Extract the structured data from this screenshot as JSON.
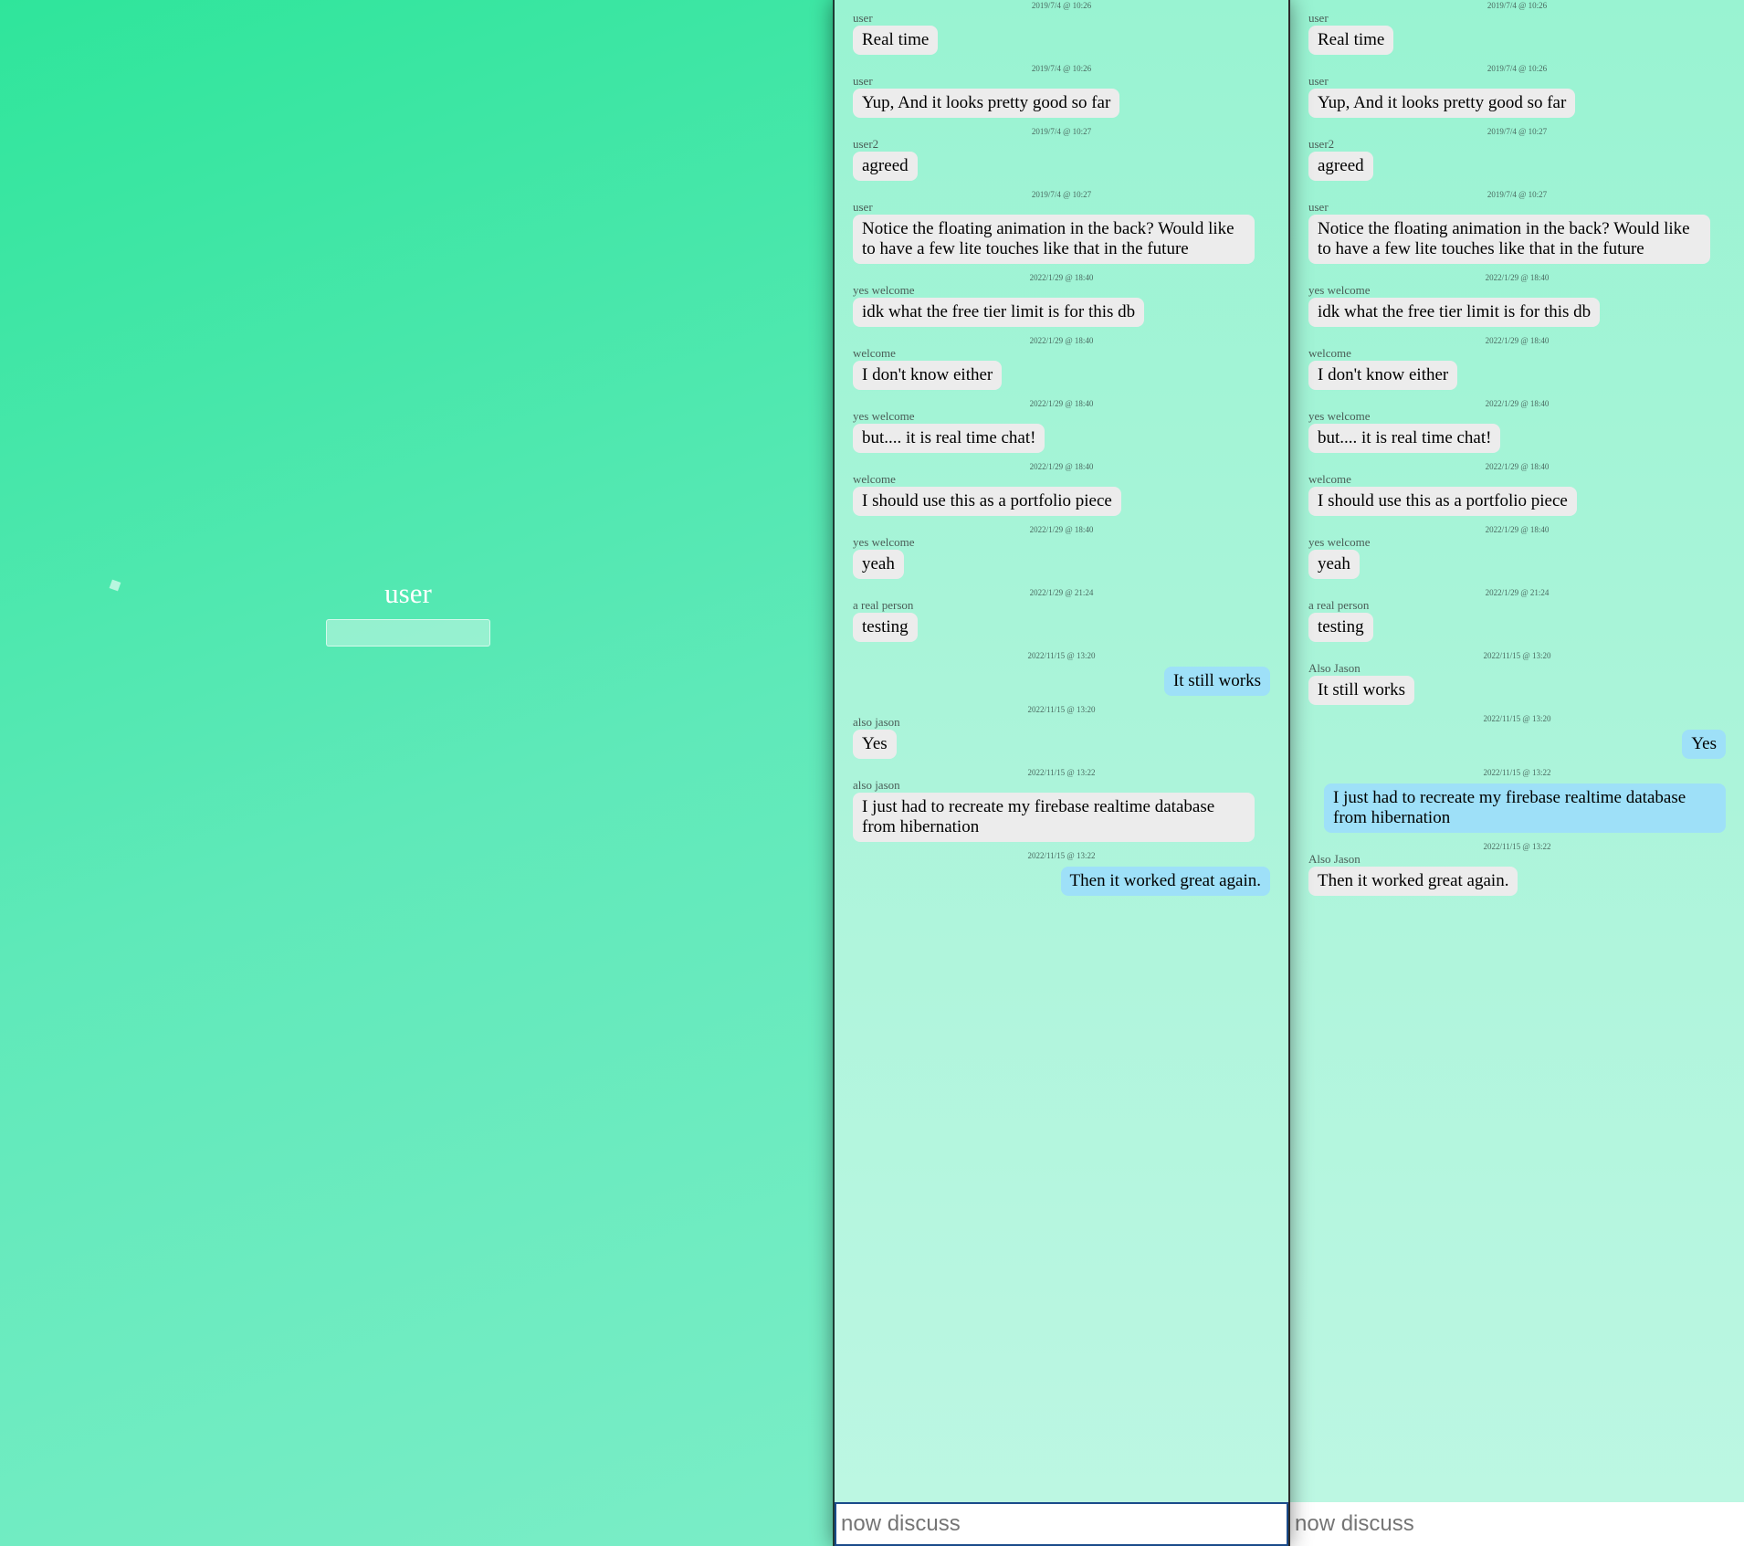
{
  "login": {
    "username": "user",
    "name_input_value": ""
  },
  "composer": {
    "placeholder": "now discuss"
  },
  "panes": [
    {
      "messages": [
        {
          "time": "2019/7/4 @ 10:26",
          "author": "user",
          "text": "Real time",
          "mine": false
        },
        {
          "time": "2019/7/4 @ 10:26",
          "author": "user",
          "text": "Yup, And it looks pretty good so far",
          "mine": false
        },
        {
          "time": "2019/7/4 @ 10:27",
          "author": "user2",
          "text": "agreed",
          "mine": false
        },
        {
          "time": "2019/7/4 @ 10:27",
          "author": "user",
          "text": "Notice the floating animation in the back? Would like to have a few lite touches like that in the future",
          "mine": false
        },
        {
          "time": "2022/1/29 @ 18:40",
          "author": "yes welcome",
          "text": "idk what the free tier limit is for this db",
          "mine": false
        },
        {
          "time": "2022/1/29 @ 18:40",
          "author": "welcome",
          "text": "I don't know either",
          "mine": false
        },
        {
          "time": "2022/1/29 @ 18:40",
          "author": "yes welcome",
          "text": "but.... it is real time chat!",
          "mine": false
        },
        {
          "time": "2022/1/29 @ 18:40",
          "author": "welcome",
          "text": "I should use this as a portfolio piece",
          "mine": false
        },
        {
          "time": "2022/1/29 @ 18:40",
          "author": "yes welcome",
          "text": "yeah",
          "mine": false
        },
        {
          "time": "2022/1/29 @ 21:24",
          "author": "a real person",
          "text": "testing",
          "mine": false
        },
        {
          "time": "2022/11/15 @ 13:20",
          "author": "",
          "text": "It still works",
          "mine": true
        },
        {
          "time": "2022/11/15 @ 13:20",
          "author": "also jason",
          "text": "Yes",
          "mine": false
        },
        {
          "time": "2022/11/15 @ 13:22",
          "author": "also jason",
          "text": "I just had to recreate my firebase realtime database from hibernation",
          "mine": false
        },
        {
          "time": "2022/11/15 @ 13:22",
          "author": "",
          "text": "Then it worked great again.",
          "mine": true
        }
      ]
    },
    {
      "messages": [
        {
          "time": "2019/7/4 @ 10:26",
          "author": "user",
          "text": "Real time",
          "mine": false
        },
        {
          "time": "2019/7/4 @ 10:26",
          "author": "user",
          "text": "Yup, And it looks pretty good so far",
          "mine": false
        },
        {
          "time": "2019/7/4 @ 10:27",
          "author": "user2",
          "text": "agreed",
          "mine": false
        },
        {
          "time": "2019/7/4 @ 10:27",
          "author": "user",
          "text": "Notice the floating animation in the back? Would like to have a few lite touches like that in the future",
          "mine": false
        },
        {
          "time": "2022/1/29 @ 18:40",
          "author": "yes welcome",
          "text": "idk what the free tier limit is for this db",
          "mine": false
        },
        {
          "time": "2022/1/29 @ 18:40",
          "author": "welcome",
          "text": "I don't know either",
          "mine": false
        },
        {
          "time": "2022/1/29 @ 18:40",
          "author": "yes welcome",
          "text": "but.... it is real time chat!",
          "mine": false
        },
        {
          "time": "2022/1/29 @ 18:40",
          "author": "welcome",
          "text": "I should use this as a portfolio piece",
          "mine": false
        },
        {
          "time": "2022/1/29 @ 18:40",
          "author": "yes welcome",
          "text": "yeah",
          "mine": false
        },
        {
          "time": "2022/1/29 @ 21:24",
          "author": "a real person",
          "text": "testing",
          "mine": false
        },
        {
          "time": "2022/11/15 @ 13:20",
          "author": "Also Jason",
          "text": "It still works",
          "mine": false
        },
        {
          "time": "2022/11/15 @ 13:20",
          "author": "",
          "text": "Yes",
          "mine": true
        },
        {
          "time": "2022/11/15 @ 13:22",
          "author": "",
          "text": "I just had to recreate my firebase realtime database from hibernation",
          "mine": true
        },
        {
          "time": "2022/11/15 @ 13:22",
          "author": "Also Jason",
          "text": "Then it worked great again.",
          "mine": false
        }
      ]
    }
  ]
}
